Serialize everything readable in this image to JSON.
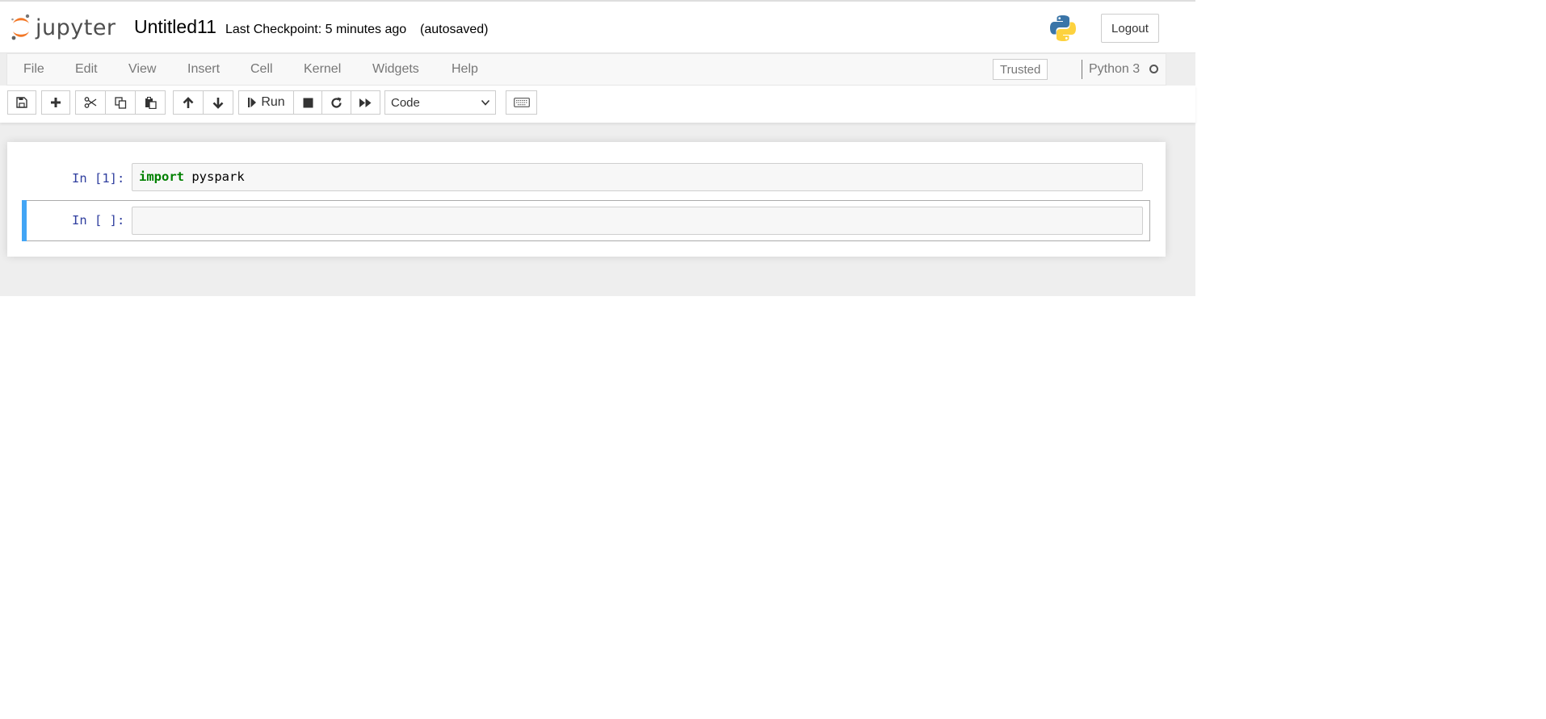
{
  "header": {
    "logo_text": "jupyter",
    "notebook_title": "Untitled11",
    "checkpoint": "Last Checkpoint: 5 minutes ago",
    "autosave": "(autosaved)",
    "logout_label": "Logout",
    "python_logo_icon": "python-logo-icon"
  },
  "menubar": {
    "items": [
      {
        "label": "File"
      },
      {
        "label": "Edit"
      },
      {
        "label": "View"
      },
      {
        "label": "Insert"
      },
      {
        "label": "Cell"
      },
      {
        "label": "Kernel"
      },
      {
        "label": "Widgets"
      },
      {
        "label": "Help"
      }
    ],
    "trusted_label": "Trusted",
    "kernel_name": "Python 3",
    "kernel_status_icon": "kernel-idle-icon"
  },
  "toolbar": {
    "icons": [
      "save-icon",
      "plus-icon",
      "cut-icon",
      "copy-icon",
      "paste-icon",
      "arrow-up-icon",
      "arrow-down-icon",
      "step-forward-icon",
      "stop-icon",
      "restart-icon",
      "fast-forward-icon",
      "keyboard-icon"
    ],
    "run_label": "Run",
    "cell_type": "Code"
  },
  "cells": [
    {
      "prompt": "In [1]:",
      "code_keyword": "import",
      "code_rest": " pyspark"
    },
    {
      "prompt": "In [ ]:",
      "code": ""
    }
  ],
  "colors": {
    "prompt": "#303f9f",
    "keyword": "#008000",
    "selected_bar": "#42a5f5",
    "logo_orange": "#f37726"
  }
}
